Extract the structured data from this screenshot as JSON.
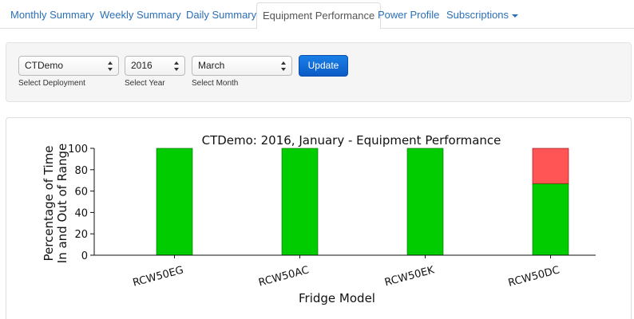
{
  "tabs": [
    {
      "label": "Monthly Summary",
      "active": false
    },
    {
      "label": "Weekly Summary",
      "active": false
    },
    {
      "label": "Daily Summary",
      "active": false
    },
    {
      "label": "Equipment Performance",
      "active": true
    },
    {
      "label": "Power Profile",
      "active": false
    },
    {
      "label": "Subscriptions",
      "active": false,
      "dropdown": true
    }
  ],
  "filters": {
    "deployment": {
      "value": "CTDemo",
      "label": "Select Deployment"
    },
    "year": {
      "value": "2016",
      "label": "Select Year"
    },
    "month": {
      "value": "March",
      "label": "Select Month"
    },
    "update_label": "Update"
  },
  "chart_data": {
    "type": "bar",
    "stacked": true,
    "title": "CTDemo: 2016, January - Equipment Performance",
    "xlabel": "Fridge Model",
    "ylabel_lines": [
      "Percentage of Time",
      "In and Out of Range"
    ],
    "categories": [
      "RCW50EG",
      "RCW50AC",
      "RCW50EK",
      "RCW50DC"
    ],
    "ylim": [
      0,
      100
    ],
    "yticks": [
      0,
      20,
      40,
      60,
      80,
      100
    ],
    "series": [
      {
        "values": [
          100,
          100,
          100,
          67
        ],
        "color": "#00cc00"
      },
      {
        "values": [
          0,
          0,
          0,
          33
        ],
        "color": "#ff5555"
      }
    ]
  }
}
